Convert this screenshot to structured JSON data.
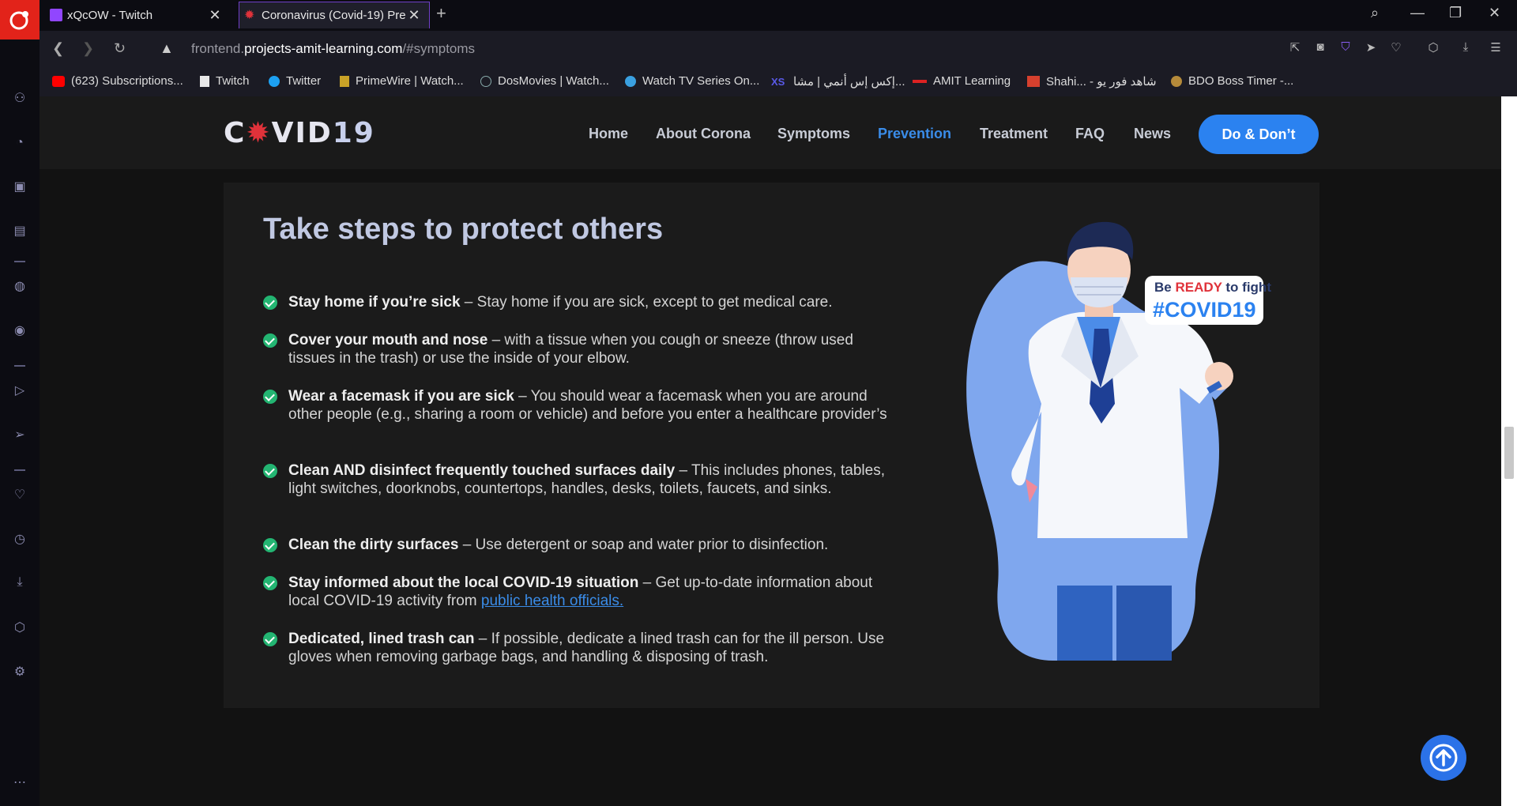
{
  "tabs": [
    {
      "title": "xQcOW - Twitch",
      "favicon": "twitch-icon"
    },
    {
      "title": "Coronavirus (Covid-19) Pre",
      "favicon": "covid-icon",
      "active": true
    }
  ],
  "address": {
    "prefix": "frontend.",
    "domain": "projects-amit-learning.com",
    "path": "/#symptoms"
  },
  "bookmarks": [
    {
      "label": "(623) Subscriptions...",
      "icon": "youtube-icon"
    },
    {
      "label": "Twitch",
      "icon": "page-icon"
    },
    {
      "label": "Twitter",
      "icon": "twitter-icon"
    },
    {
      "label": "PrimeWire | Watch...",
      "icon": "primewire-icon"
    },
    {
      "label": "DosMovies | Watch...",
      "icon": "dosmovies-icon"
    },
    {
      "label": "Watch TV Series On...",
      "icon": "tv-icon"
    },
    {
      "label": "إكس إس أنمي | مشا...",
      "icon": "xs-icon"
    },
    {
      "label": "AMIT Learning",
      "icon": "amit-icon"
    },
    {
      "label": "Shahi... - شاهد فور يو",
      "icon": "shahid-icon"
    },
    {
      "label": "BDO Boss Timer -...",
      "icon": "bdo-icon"
    }
  ],
  "site": {
    "logo": {
      "c": "C",
      "virus": "✹",
      "rest": "VID",
      "num": "19"
    },
    "nav": [
      "Home",
      "About Corona",
      "Symptoms",
      "Prevention",
      "Treatment",
      "FAQ",
      "News"
    ],
    "active_nav": "Prevention",
    "cta": "Do & Don’t"
  },
  "section": {
    "title": "Take steps to protect others",
    "items": [
      {
        "bold": "Stay home if you’re sick",
        "text": " – Stay home if you are sick, except to get medical care."
      },
      {
        "bold": "Cover your mouth and nose",
        "text": " – with a tissue when you cough or sneeze (throw used tissues in the trash) or use the inside of your elbow."
      },
      {
        "bold": "Wear a facemask if you are sick",
        "text": " – You should wear a facemask when you are around other people (e.g., sharing a room or vehicle) and before you enter a healthcare provider’s"
      },
      {
        "bold": "Clean AND disinfect frequently touched surfaces daily",
        "text": " – This includes phones, tables, light switches, doorknobs, countertops, handles, desks, toilets, faucets, and sinks."
      },
      {
        "bold": "Clean the dirty surfaces",
        "text": " – Use detergent or soap and water prior to disinfection."
      },
      {
        "bold": "Stay informed about the local COVID-19 situation",
        "text": " – Get up-to-date information about local COVID-19 activity from ",
        "link": "public health officials."
      },
      {
        "bold": "Dedicated, lined trash can",
        "text": " – If possible, dedicate a lined trash can for the ill person. Use gloves when removing garbage bags, and handling & disposing of trash."
      }
    ],
    "illustration": {
      "badge_pre": "Be ",
      "badge_ready": "READY",
      "badge_post": " to fight",
      "hashtag": "#COVID19"
    }
  },
  "colors": {
    "accent": "#2b82f0",
    "check": "#23b572",
    "opera": "#e2231a",
    "tab_border": "#6f3fc7"
  }
}
